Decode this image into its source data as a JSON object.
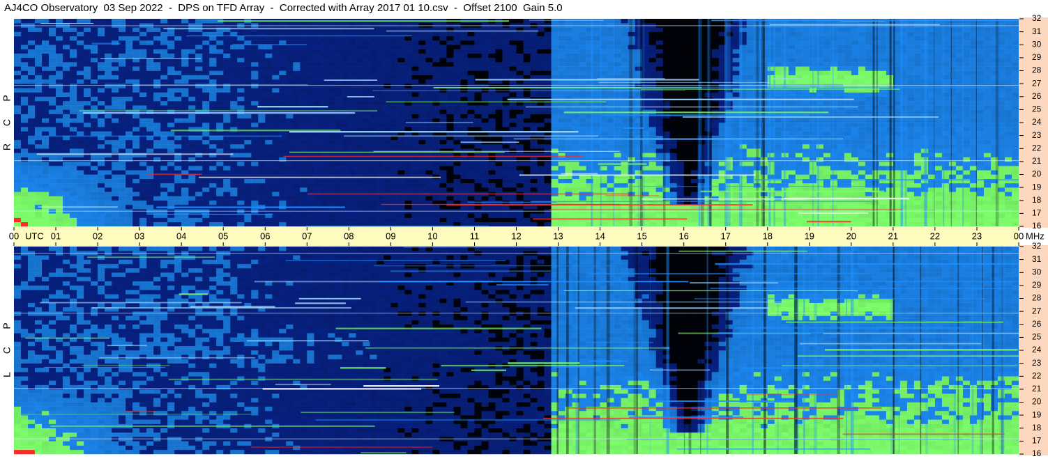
{
  "title": "AJ4CO Observatory  03 Sep 2022  -  DPS on TFD Array  -  Corrected with Array 2017 01 10.csv  -  Offset 2100  Gain 5.0",
  "chart_data": {
    "type": "heatmap",
    "panels": [
      {
        "name": "RCP",
        "label_letters": [
          "P",
          "C",
          "R"
        ]
      },
      {
        "name": "LCP",
        "label_letters": [
          "P",
          "C",
          "L"
        ]
      }
    ],
    "x_axis": {
      "unit_label": "UTC",
      "range_hours": [
        0,
        24
      ],
      "tick_labels": [
        "00",
        "01",
        "02",
        "03",
        "04",
        "05",
        "06",
        "07",
        "08",
        "09",
        "10",
        "11",
        "12",
        "13",
        "14",
        "15",
        "16",
        "17",
        "18",
        "19",
        "20",
        "21",
        "22",
        "23",
        "00"
      ]
    },
    "y_axis": {
      "unit_label": "MHz",
      "range_mhz": [
        16,
        32
      ],
      "tick_labels": [
        "32",
        "31",
        "30",
        "29",
        "28",
        "27",
        "26",
        "25",
        "24",
        "23",
        "22",
        "21",
        "20",
        "19",
        "18",
        "17",
        "16"
      ]
    },
    "colors": {
      "background": "#02030a",
      "low": "#0a2aa0",
      "mid": "#1e90ff",
      "high": "#7cfc6a",
      "peak": "#ff2a2a",
      "hour_band": "#fffbbf",
      "freq_band": "#fdd8be"
    }
  }
}
